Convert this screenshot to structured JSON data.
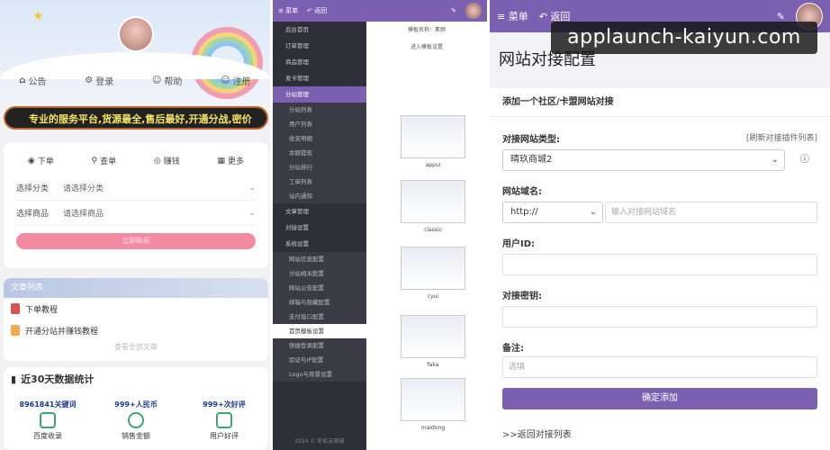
{
  "watermark": "applaunch-kaiyun.com",
  "shop": {
    "nav": [
      "公告",
      "登录",
      "帮助",
      "注册"
    ],
    "marquee": "专业的服务平台,货源最全,售后最好,开通分战,密价",
    "tabs": [
      "下单",
      "查单",
      "赚钱",
      "更多"
    ],
    "category_label": "选择分类",
    "category_value": "请选择分类",
    "product_label": "选择商品",
    "product_value": "请选择商品",
    "buy_label": "立即购买",
    "articles_title": "文章列表",
    "articles": [
      "下单教程",
      "开通分站并赚钱教程"
    ],
    "articles_more": "查看全部文章",
    "stats_title": "近30天数据统计",
    "stats": [
      {
        "value": "8961841关键词",
        "caption": "百度收录"
      },
      {
        "value": "999+人民币",
        "caption": "销售金额"
      },
      {
        "value": "999+次好评",
        "caption": "用户好评"
      }
    ]
  },
  "admin": {
    "menu_label": "菜单",
    "back_label": "返回",
    "sidebar": [
      {
        "label": "后台首页",
        "type": "item"
      },
      {
        "label": "订单管理",
        "type": "item"
      },
      {
        "label": "商品管理",
        "type": "item"
      },
      {
        "label": "发卡管理",
        "type": "item"
      },
      {
        "label": "分站管理",
        "type": "active"
      },
      {
        "label": "分站列表",
        "type": "sub"
      },
      {
        "label": "用户列表",
        "type": "sub"
      },
      {
        "label": "收支明细",
        "type": "sub"
      },
      {
        "label": "余额提现",
        "type": "sub"
      },
      {
        "label": "分站排行",
        "type": "sub"
      },
      {
        "label": "工单列表",
        "type": "sub"
      },
      {
        "label": "站内通知",
        "type": "sub"
      },
      {
        "label": "文章管理",
        "type": "item"
      },
      {
        "label": "对接设置",
        "type": "item"
      },
      {
        "label": "系统设置",
        "type": "open"
      },
      {
        "label": "网站信息配置",
        "type": "sub"
      },
      {
        "label": "分站相关配置",
        "type": "sub"
      },
      {
        "label": "网站公告配置",
        "type": "sub"
      },
      {
        "label": "邮箱与隐藏配置",
        "type": "sub"
      },
      {
        "label": "支付接口配置",
        "type": "sub"
      },
      {
        "label": "首页模板设置",
        "type": "selected"
      },
      {
        "label": "快捷登录配置",
        "type": "sub"
      },
      {
        "label": "验证与IP配置",
        "type": "sub"
      },
      {
        "label": "Logo与背景设置",
        "type": "sub"
      }
    ],
    "footer": "2024 © 彩虹云商城",
    "template_name": "模板名称：素颜",
    "template_link": "进入模板设置",
    "templates": [
      "appui",
      "classic",
      "cyui",
      "faka",
      "maidong"
    ]
  },
  "config": {
    "menu_label": "菜单",
    "back_label": "返回",
    "page_title": "网站对接配置",
    "form_title": "添加一个社区/卡盟网站对接",
    "type_label": "对接网站类型:",
    "refresh_link": "[刷新对接插件列表]",
    "type_value": "晴玖商城2",
    "domain_label": "网站域名:",
    "protocol": "http://",
    "domain_placeholder": "输入对接网站域名",
    "userid_label": "用户ID:",
    "key_label": "对接密钥:",
    "remark_label": "备注:",
    "remark_placeholder": "选填",
    "submit_label": "确定添加",
    "back_link": ">>返回对接列表"
  },
  "colors": {
    "accent": "#7b5fb0",
    "sidebar": "#2e2f3a",
    "buy": "#f28aa1"
  }
}
